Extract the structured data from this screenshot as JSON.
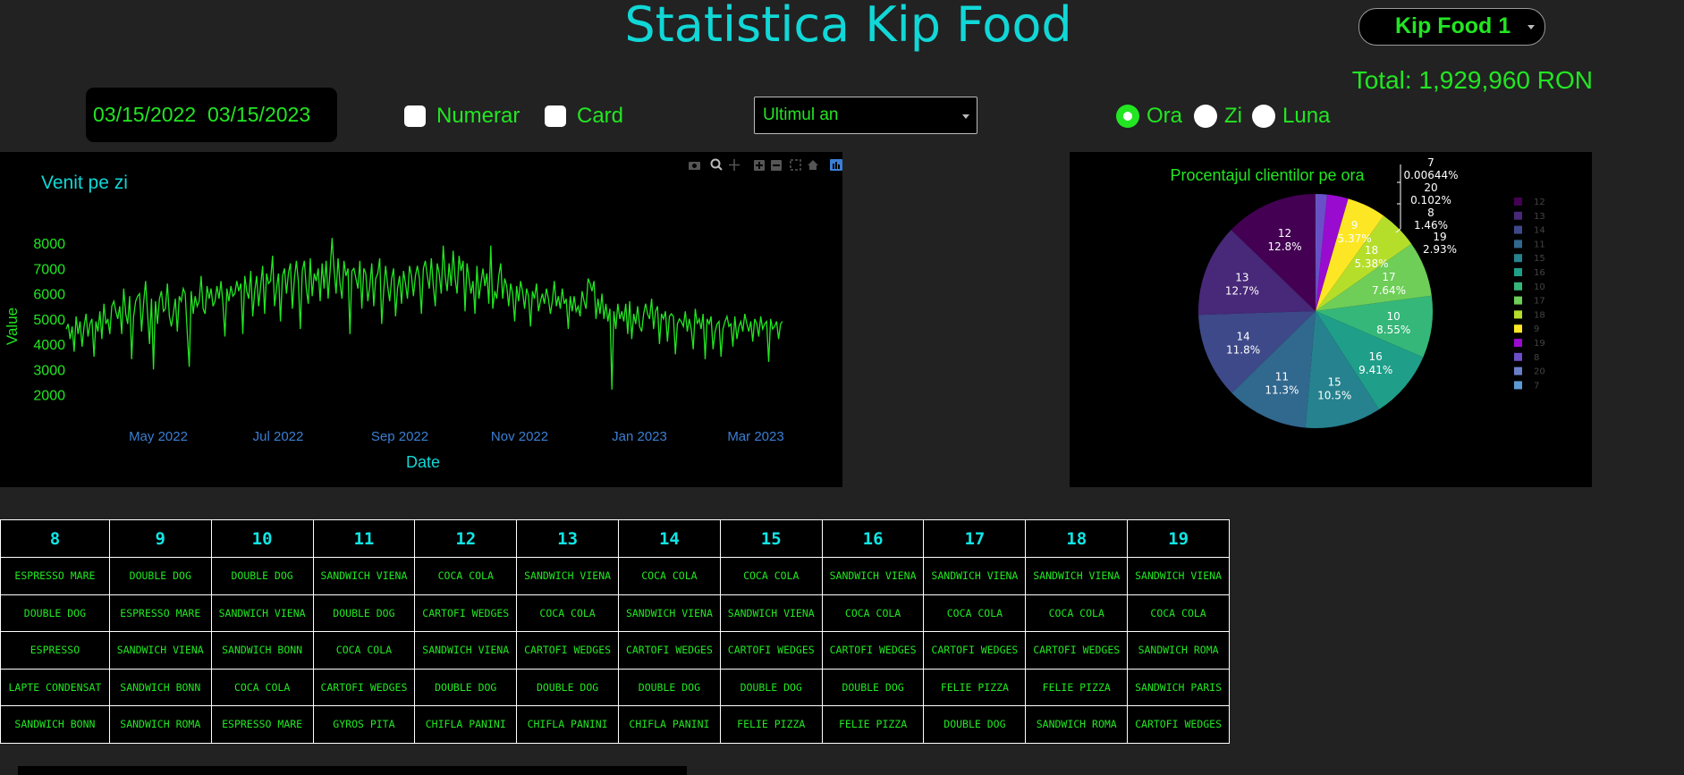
{
  "header": {
    "title": "Statistica Kip Food"
  },
  "store_select": {
    "value": "Kip Food 1"
  },
  "total": {
    "text": "Total: 1,929,960 RON"
  },
  "date_range": {
    "start": "03/15/2022",
    "end": "03/15/2023"
  },
  "payment_filters": [
    {
      "label": "Numerar",
      "checked": false
    },
    {
      "label": "Card",
      "checked": false
    }
  ],
  "period_select": {
    "value": "Ultimul an"
  },
  "granularity": [
    {
      "label": "Ora",
      "selected": true
    },
    {
      "label": "Zi",
      "selected": false
    },
    {
      "label": "Luna",
      "selected": false
    }
  ],
  "colors": {
    "background": "#222222",
    "panel": "#000000",
    "accent_green": "#22e622",
    "accent_cyan": "#11d7d7"
  },
  "chart_data": [
    {
      "type": "line",
      "title": "Venit pe zi",
      "xlabel": "Date",
      "ylabel": "Value",
      "x_range": [
        "2022-03-15",
        "2023-03-15"
      ],
      "x_ticks": [
        "May 2022",
        "Jul 2022",
        "Sep 2022",
        "Nov 2022",
        "Jan 2023",
        "Mar 2023"
      ],
      "y_ticks": [
        2000,
        3000,
        4000,
        5000,
        6000,
        7000,
        8000
      ],
      "ylim": [
        1600,
        8300
      ],
      "series": [
        {
          "values": [
            4600,
            4800,
            4200,
            4700,
            3700,
            5100,
            4400,
            4900,
            3900,
            4700,
            5200,
            4300,
            4800,
            5000,
            3500,
            4900,
            4500,
            5300,
            4200,
            5600,
            4800,
            5000,
            4400,
            5500,
            5700,
            5300,
            5000,
            5500,
            4400,
            6200,
            5200,
            4800,
            5900,
            3400,
            5100,
            5700,
            5900,
            6000,
            4500,
            5600,
            6500,
            5200,
            4000,
            5800,
            3000,
            5700,
            4800,
            5800,
            6100,
            5300,
            5400,
            6400,
            5100,
            4700,
            5200,
            5800,
            4500,
            5900,
            5700,
            6200,
            6000,
            4500,
            3100,
            6100,
            5200,
            5900,
            5500,
            5700,
            6700,
            5400,
            5200,
            6300,
            5800,
            6200,
            5500,
            5700,
            6300,
            5800,
            6500,
            5600,
            4300,
            6200,
            5700,
            6300,
            5900,
            6000,
            6500,
            6100,
            6400,
            4400,
            6700,
            6100,
            5800,
            6900,
            5100,
            6100,
            6700,
            5500,
            6300,
            7100,
            5200,
            6800,
            6400,
            6500,
            7500,
            5500,
            6200,
            6800,
            4900,
            6700,
            7000,
            6000,
            6800,
            7200,
            5400,
            6600,
            7300,
            6500,
            4600,
            6900,
            7300,
            6200,
            5600,
            7400,
            5900,
            6800,
            6500,
            7000,
            5700,
            7200,
            6200,
            7300,
            5800,
            6900,
            8200,
            7000,
            6000,
            7400,
            6400,
            5800,
            7300,
            6700,
            7000,
            4400,
            6900,
            7000,
            6600,
            6200,
            7300,
            5400,
            7000,
            6800,
            5700,
            6300,
            7200,
            5500,
            6600,
            6800,
            7400,
            4800,
            6100,
            7100,
            6300,
            5700,
            6600,
            7000,
            5100,
            6200,
            6700,
            5600,
            6900,
            6400,
            5800,
            7100,
            6700,
            5900,
            6700,
            7100,
            6600,
            5200,
            7000,
            7300,
            6700,
            6200,
            7400,
            6300,
            5500,
            7200,
            6800,
            6000,
            7900,
            6700,
            6100,
            7200,
            6300,
            7700,
            6600,
            6000,
            7500,
            6900,
            7300,
            5300,
            7200,
            6600,
            6000,
            6500,
            5200,
            7100,
            5800,
            6400,
            7000,
            6300,
            6800,
            5600,
            7900,
            5400,
            6100,
            5800,
            6700,
            7200,
            5800,
            6600,
            6300,
            5500,
            6400,
            6000,
            4900,
            6300,
            5700,
            6500,
            6100,
            5400,
            6200,
            5900,
            4700,
            6100,
            5800,
            6400,
            5300,
            5700,
            6000,
            5600,
            6200,
            5800,
            5200,
            5700,
            6500,
            5500,
            5900,
            5400,
            6200,
            5600,
            5800,
            4600,
            5900,
            5300,
            5900,
            5300,
            5500,
            5100,
            6100,
            5700,
            5400,
            6600,
            6400,
            6100,
            6500,
            5000,
            5800,
            5200,
            6000,
            5000,
            5600,
            4900,
            5400,
            2200,
            5300,
            4600,
            5600,
            5000,
            5300,
            4900,
            5600,
            4400,
            5700,
            4200,
            5200,
            4800,
            5500,
            4700,
            4500,
            5200,
            5600,
            5200,
            5000,
            5800,
            4600,
            5300,
            5500,
            4000,
            5200,
            5000,
            5300,
            4100,
            5100,
            5200,
            5100,
            3600,
            4800,
            5000,
            4900,
            4700,
            5300,
            4500,
            5000,
            4600,
            3800,
            5400,
            4800,
            5000,
            4600,
            5200,
            3400,
            5000,
            4800,
            5100,
            3800,
            4500,
            4800,
            4900,
            3500,
            4600,
            4900,
            5100,
            4700,
            4800,
            3900,
            5100,
            4200,
            4700,
            4900,
            4500,
            5200,
            4800,
            4500,
            4900,
            4100,
            5000,
            4800,
            4300,
            5100,
            4600,
            4800,
            4900,
            3300,
            5000,
            4600,
            4700,
            4900,
            4200,
            4800,
            4900
          ]
        }
      ]
    },
    {
      "type": "pie",
      "title": "Procentajul clientilor pe ora",
      "legend_position": "right",
      "slices": [
        {
          "label": "12",
          "percent": 12.8,
          "color": "#440154"
        },
        {
          "label": "13",
          "percent": 12.7,
          "color": "#482878"
        },
        {
          "label": "14",
          "percent": 11.8,
          "color": "#3e4989"
        },
        {
          "label": "11",
          "percent": 11.3,
          "color": "#31688e"
        },
        {
          "label": "15",
          "percent": 10.5,
          "color": "#26828e"
        },
        {
          "label": "16",
          "percent": 9.41,
          "color": "#1f9e89"
        },
        {
          "label": "10",
          "percent": 8.55,
          "color": "#35b779"
        },
        {
          "label": "17",
          "percent": 7.64,
          "color": "#6ece58"
        },
        {
          "label": "18",
          "percent": 5.38,
          "color": "#b5de2b"
        },
        {
          "label": "9",
          "percent": 5.37,
          "color": "#fde725"
        },
        {
          "label": "19",
          "percent": 2.93,
          "color": "#9a0bd0"
        },
        {
          "label": "8",
          "percent": 1.46,
          "color": "#6a4fc9"
        },
        {
          "label": "20",
          "percent": 0.102,
          "color": "#6a7fc9"
        },
        {
          "label": "7",
          "percent": 0.00644,
          "color": "#5b9bd5"
        }
      ],
      "slice_labels": [
        {
          "hour": "12",
          "pct": "12.8%"
        },
        {
          "hour": "13",
          "pct": "12.7%"
        },
        {
          "hour": "14",
          "pct": "11.8%"
        },
        {
          "hour": "11",
          "pct": "11.3%"
        },
        {
          "hour": "15",
          "pct": "10.5%"
        },
        {
          "hour": "16",
          "pct": "9.41%"
        },
        {
          "hour": "10",
          "pct": "8.55%"
        },
        {
          "hour": "17",
          "pct": "7.64%"
        },
        {
          "hour": "18",
          "pct": "5.38%"
        },
        {
          "hour": "9",
          "pct": "5.37%"
        },
        {
          "hour": "19",
          "pct": "2.93%"
        },
        {
          "hour": "8",
          "pct": "1.46%"
        },
        {
          "hour": "20",
          "pct": "0.102%"
        },
        {
          "hour": "7",
          "pct": "0.00644%"
        }
      ]
    }
  ],
  "top_products_table": {
    "headers": [
      "8",
      "9",
      "10",
      "11",
      "12",
      "13",
      "14",
      "15",
      "16",
      "17",
      "18",
      "19"
    ],
    "rows": [
      [
        "ESPRESSO MARE",
        "DOUBLE DOG",
        "DOUBLE DOG",
        "SANDWICH VIENA",
        "COCA COLA",
        "SANDWICH VIENA",
        "COCA COLA",
        "COCA COLA",
        "SANDWICH VIENA",
        "SANDWICH VIENA",
        "SANDWICH VIENA",
        "SANDWICH VIENA"
      ],
      [
        "DOUBLE DOG",
        "ESPRESSO MARE",
        "SANDWICH VIENA",
        "DOUBLE DOG",
        "CARTOFI WEDGES",
        "COCA COLA",
        "SANDWICH VIENA",
        "SANDWICH VIENA",
        "COCA COLA",
        "COCA COLA",
        "COCA COLA",
        "COCA COLA"
      ],
      [
        "ESPRESSO",
        "SANDWICH VIENA",
        "SANDWICH BONN",
        "COCA COLA",
        "SANDWICH VIENA",
        "CARTOFI WEDGES",
        "CARTOFI WEDGES",
        "CARTOFI WEDGES",
        "CARTOFI WEDGES",
        "CARTOFI WEDGES",
        "CARTOFI WEDGES",
        "SANDWICH ROMA"
      ],
      [
        "LAPTE CONDENSAT",
        "SANDWICH BONN",
        "COCA COLA",
        "CARTOFI WEDGES",
        "DOUBLE DOG",
        "DOUBLE DOG",
        "DOUBLE DOG",
        "DOUBLE DOG",
        "DOUBLE DOG",
        "FELIE PIZZA",
        "FELIE PIZZA",
        "SANDWICH PARIS"
      ],
      [
        "SANDWICH BONN",
        "SANDWICH ROMA",
        "ESPRESSO MARE",
        "GYROS PITA",
        "CHIFLA PANINI",
        "CHIFLA PANINI",
        "CHIFLA PANINI",
        "FELIE PIZZA",
        "FELIE PIZZA",
        "DOUBLE DOG",
        "SANDWICH ROMA",
        "CARTOFI WEDGES"
      ]
    ]
  },
  "modebar_icons": [
    "camera-icon",
    "zoom-icon",
    "pan-icon",
    "zoom-in-icon",
    "zoom-out-icon",
    "autoscale-icon",
    "home-icon",
    "plotly-logo-icon"
  ]
}
